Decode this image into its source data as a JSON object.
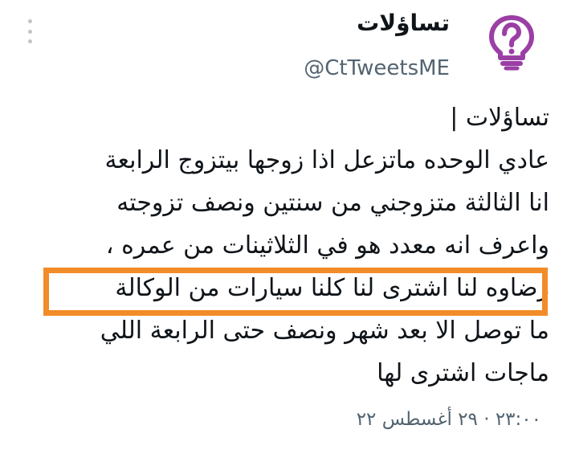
{
  "tweet": {
    "display_name": "تساؤلات",
    "handle": "@CtTweetsME",
    "avatar_icon": "lightbulb-question-icon",
    "menu_icon": "more-vertical-icon",
    "accent_color": "#9b3fa5",
    "highlight_color": "#f28c28",
    "lines": [
      "تساؤلات |",
      "عادي الوحده ماتزعل اذا زوجها بيتزوج الرابعة",
      "انا الثالثة متزوجني من سنتين ونصف تزوجته",
      "واعرف انه معدد هو في الثلاثينات من عمره ،",
      "رضاوه لنا اشترى لنا كلنا سيارات من الوكالة",
      "ما توصل الا بعد شهر ونصف حتى الرابعة اللي",
      "ماجات اشترى لها"
    ],
    "timestamp": "٢٣:٠٠ ‏· ٢٩ أغسطس ٢٢"
  }
}
